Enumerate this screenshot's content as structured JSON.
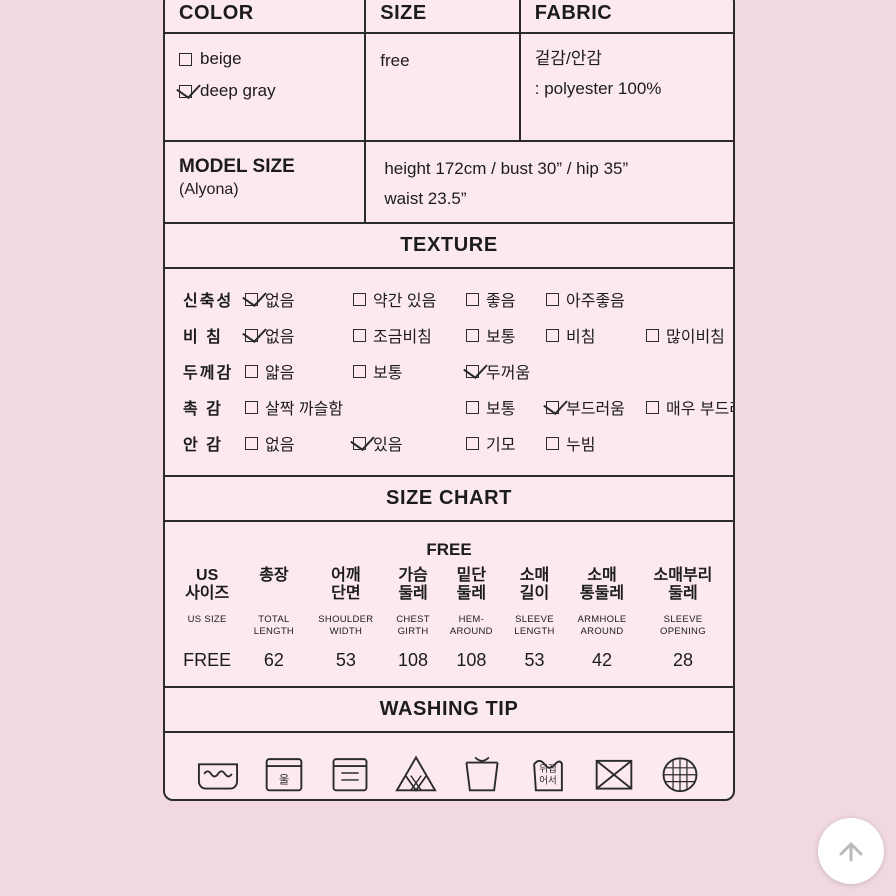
{
  "headers": {
    "color": "COLOR",
    "size": "SIZE",
    "fabric": "FABRIC"
  },
  "color": {
    "options": [
      {
        "label": "beige",
        "checked": false
      },
      {
        "label": "deep gray",
        "checked": true
      }
    ]
  },
  "size": {
    "value": "free"
  },
  "fabric": {
    "line1": "겉감/안감",
    "line2": ": polyester 100%"
  },
  "model_size": {
    "label": "MODEL SIZE",
    "name": "(Alyona)",
    "line1": "height 172cm / bust 30” / hip 35”",
    "line2": "waist 23.5”"
  },
  "texture": {
    "title": "TEXTURE",
    "rows": [
      {
        "key": "신축성",
        "options": [
          {
            "label": "없음",
            "checked": true
          },
          {
            "label": "약간 있음",
            "checked": false
          },
          {
            "label": "좋음",
            "checked": false
          },
          {
            "label": "아주좋음",
            "checked": false
          }
        ]
      },
      {
        "key": "비 침",
        "options": [
          {
            "label": "없음",
            "checked": true
          },
          {
            "label": "조금비침",
            "checked": false
          },
          {
            "label": "보통",
            "checked": false
          },
          {
            "label": "비침",
            "checked": false
          },
          {
            "label": "많이비침",
            "checked": false
          }
        ]
      },
      {
        "key": "두께감",
        "options": [
          {
            "label": "얇음",
            "checked": false
          },
          {
            "label": "보통",
            "checked": false
          },
          {
            "label": "두꺼움",
            "checked": true
          }
        ]
      },
      {
        "key": "촉 감",
        "options": [
          {
            "label": "살짝 까슬함",
            "checked": false
          },
          {
            "label": "보통",
            "checked": false
          },
          {
            "label": "부드러움",
            "checked": true
          },
          {
            "label": "매우 부드러움",
            "checked": false
          }
        ]
      },
      {
        "key": "안 감",
        "options": [
          {
            "label": "없음",
            "checked": false
          },
          {
            "label": "있음",
            "checked": true
          },
          {
            "label": "기모",
            "checked": false
          },
          {
            "label": "누빔",
            "checked": false
          }
        ]
      }
    ]
  },
  "size_chart": {
    "title": "SIZE CHART",
    "free_label": "FREE",
    "columns": [
      {
        "kr": "US\n사이즈",
        "en": "US SIZE",
        "value": "FREE"
      },
      {
        "kr": "총장",
        "en": "TOTAL\nLENGTH",
        "value": "62"
      },
      {
        "kr": "어깨\n단면",
        "en": "SHOULDER\nWIDTH",
        "value": "53"
      },
      {
        "kr": "가슴\n둘레",
        "en": "CHEST\nGIRTH",
        "value": "108"
      },
      {
        "kr": "밑단\n둘레",
        "en": "HEM-\nAROUND",
        "value": "108"
      },
      {
        "kr": "소매\n길이",
        "en": "SLEEVE\nLENGTH",
        "value": "53"
      },
      {
        "kr": "소매\n통둘레",
        "en": "ARMHOLE\nAROUND",
        "value": "42"
      },
      {
        "kr": "소매부리\n둘레",
        "en": "SLEEVE\nOPENING",
        "value": "28"
      }
    ]
  },
  "washing": {
    "title": "WASHING TIP",
    "icons": [
      {
        "name": "hand-wash-icon",
        "caption": ""
      },
      {
        "name": "do-not-bleach-water-icon",
        "caption": "울"
      },
      {
        "name": "tumble-dry-icon",
        "caption": ""
      },
      {
        "name": "do-not-bleach-icon",
        "caption": ""
      },
      {
        "name": "drip-dry-icon",
        "caption": ""
      },
      {
        "name": "dry-flat-icon",
        "caption": "뒤집\n어서"
      },
      {
        "name": "do-not-iron-icon",
        "caption": ""
      },
      {
        "name": "dry-clean-icon",
        "caption": ""
      }
    ]
  },
  "scroll_top": {
    "name": "scroll-to-top-button"
  },
  "colors": {
    "page_background": "#f2d9e1",
    "card_background": "#fbe9ef",
    "border": "#2b2b2b",
    "text": "#1c1c1c"
  }
}
